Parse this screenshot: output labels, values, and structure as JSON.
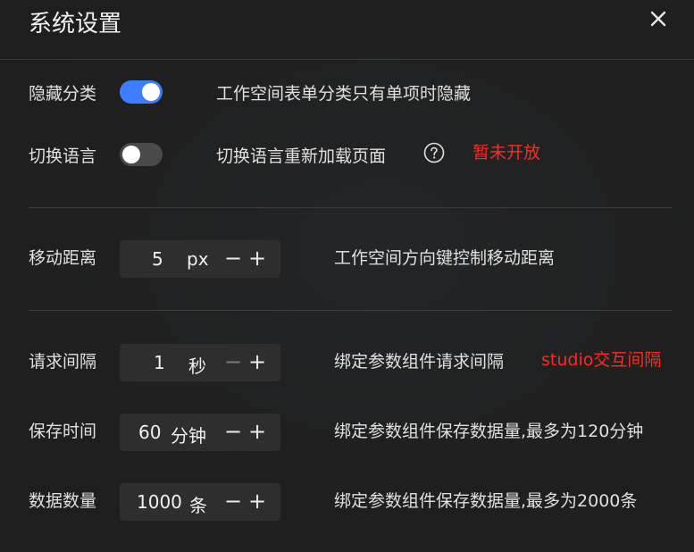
{
  "dialog": {
    "title": "系统设置",
    "close_icon": "close-icon"
  },
  "settings": {
    "hide_category": {
      "label": "隐藏分类",
      "enabled": true,
      "description": "工作空间表单分类只有单项时隐藏"
    },
    "switch_language": {
      "label": "切换语言",
      "enabled": false,
      "description": "切换语言重新加载页面",
      "help_icon": "question-circle-icon",
      "note": "暂未开放"
    },
    "move_distance": {
      "label": "移动距离",
      "value": "5",
      "unit": "px",
      "minus": "−",
      "plus": "+",
      "description": "工作空间方向键控制移动距离"
    },
    "request_interval": {
      "label": "请求间隔",
      "value": "1",
      "unit": "秒",
      "minus": "−",
      "plus": "+",
      "description": "绑定参数组件请求间隔",
      "note": "studio交互间隔"
    },
    "save_time": {
      "label": "保存时间",
      "value": "60",
      "unit": "分钟",
      "minus": "−",
      "plus": "+",
      "description": "绑定参数组件保存数据量,最多为120分钟"
    },
    "data_count": {
      "label": "数据数量",
      "value": "1000",
      "unit": "条",
      "minus": "−",
      "plus": "+",
      "description": "绑定参数组件保存数据量,最多为2000条"
    }
  },
  "colors": {
    "accent": "#3d7eff",
    "note": "#ff2a1f",
    "background": "#1f1f1f"
  }
}
